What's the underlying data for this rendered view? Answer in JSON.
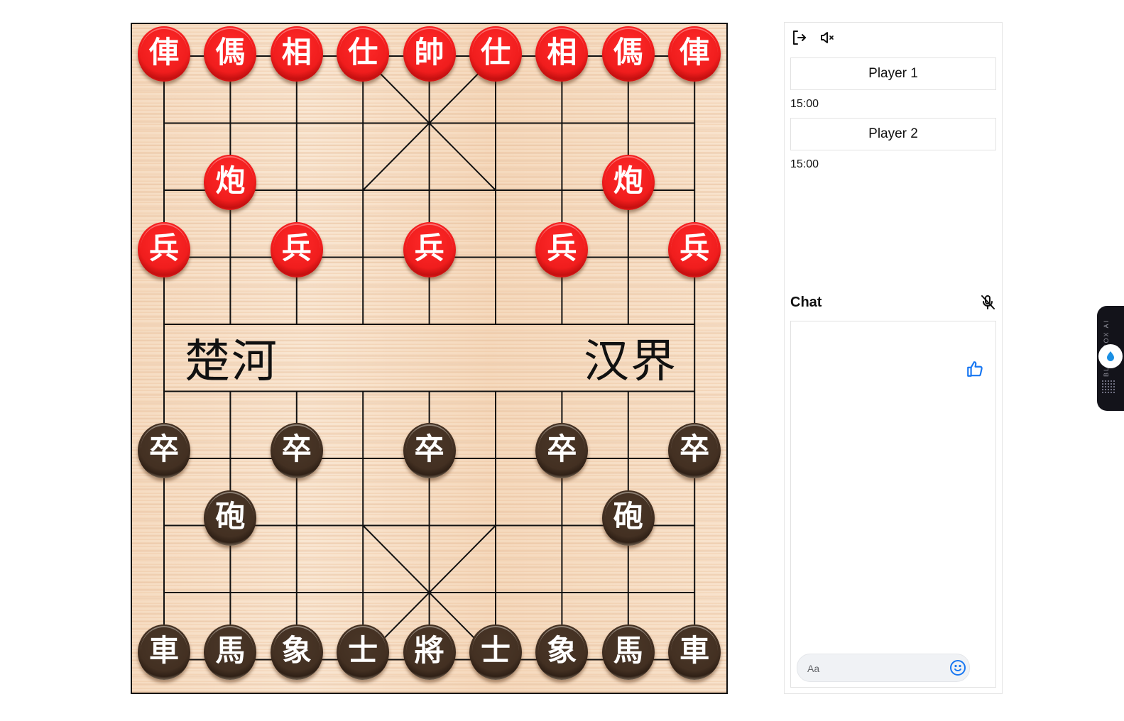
{
  "board": {
    "river_left": "楚河",
    "river_right": "汉界",
    "files": 9,
    "ranks": 10,
    "pieces": [
      {
        "side": "red",
        "char": "俥",
        "file": 0,
        "rank": 0
      },
      {
        "side": "red",
        "char": "傌",
        "file": 1,
        "rank": 0
      },
      {
        "side": "red",
        "char": "相",
        "file": 2,
        "rank": 0
      },
      {
        "side": "red",
        "char": "仕",
        "file": 3,
        "rank": 0
      },
      {
        "side": "red",
        "char": "帥",
        "file": 4,
        "rank": 0
      },
      {
        "side": "red",
        "char": "仕",
        "file": 5,
        "rank": 0
      },
      {
        "side": "red",
        "char": "相",
        "file": 6,
        "rank": 0
      },
      {
        "side": "red",
        "char": "傌",
        "file": 7,
        "rank": 0
      },
      {
        "side": "red",
        "char": "俥",
        "file": 8,
        "rank": 0
      },
      {
        "side": "red",
        "char": "炮",
        "file": 1,
        "rank": 2
      },
      {
        "side": "red",
        "char": "炮",
        "file": 7,
        "rank": 2
      },
      {
        "side": "red",
        "char": "兵",
        "file": 0,
        "rank": 3
      },
      {
        "side": "red",
        "char": "兵",
        "file": 2,
        "rank": 3
      },
      {
        "side": "red",
        "char": "兵",
        "file": 4,
        "rank": 3
      },
      {
        "side": "red",
        "char": "兵",
        "file": 6,
        "rank": 3
      },
      {
        "side": "red",
        "char": "兵",
        "file": 8,
        "rank": 3
      },
      {
        "side": "black",
        "char": "卒",
        "file": 0,
        "rank": 6
      },
      {
        "side": "black",
        "char": "卒",
        "file": 2,
        "rank": 6
      },
      {
        "side": "black",
        "char": "卒",
        "file": 4,
        "rank": 6
      },
      {
        "side": "black",
        "char": "卒",
        "file": 6,
        "rank": 6
      },
      {
        "side": "black",
        "char": "卒",
        "file": 8,
        "rank": 6
      },
      {
        "side": "black",
        "char": "砲",
        "file": 1,
        "rank": 7
      },
      {
        "side": "black",
        "char": "砲",
        "file": 7,
        "rank": 7
      },
      {
        "side": "black",
        "char": "車",
        "file": 0,
        "rank": 9
      },
      {
        "side": "black",
        "char": "馬",
        "file": 1,
        "rank": 9
      },
      {
        "side": "black",
        "char": "象",
        "file": 2,
        "rank": 9
      },
      {
        "side": "black",
        "char": "士",
        "file": 3,
        "rank": 9
      },
      {
        "side": "black",
        "char": "將",
        "file": 4,
        "rank": 9
      },
      {
        "side": "black",
        "char": "士",
        "file": 5,
        "rank": 9
      },
      {
        "side": "black",
        "char": "象",
        "file": 6,
        "rank": 9
      },
      {
        "side": "black",
        "char": "馬",
        "file": 7,
        "rank": 9
      },
      {
        "side": "black",
        "char": "車",
        "file": 8,
        "rank": 9
      }
    ]
  },
  "panel": {
    "exit_icon": "exit-icon",
    "mute_icon": "volume-mute-icon",
    "player1": {
      "name": "Player 1",
      "time": "15:00"
    },
    "player2": {
      "name": "Player 2",
      "time": "15:00"
    },
    "chat": {
      "title": "Chat",
      "mic_icon": "mic-off-icon",
      "input_placeholder": "Aa",
      "input_value": "",
      "emoji_icon": "emoji-icon",
      "like_icon": "thumbs-up-icon",
      "accent_color": "#1877f2"
    }
  },
  "widget": {
    "label": "BLACKBOX AI"
  }
}
